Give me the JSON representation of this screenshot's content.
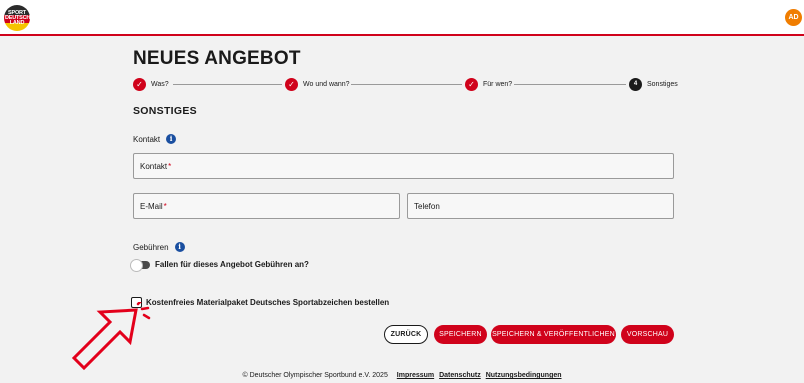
{
  "header": {
    "logo_lines": [
      "SPORT",
      "DEUTSCH",
      "LAND"
    ],
    "avatar_initials": "AD"
  },
  "page": {
    "title": "NEUES ANGEBOT"
  },
  "stepper": {
    "steps": [
      {
        "label": "Was?",
        "state": "done",
        "marker": "✓"
      },
      {
        "label": "Wo und wann?",
        "state": "done",
        "marker": "✓"
      },
      {
        "label": "Für wen?",
        "state": "done",
        "marker": "✓"
      },
      {
        "label": "Sonstiges",
        "state": "current",
        "marker": "4"
      }
    ]
  },
  "section": {
    "title": "SONSTIGES"
  },
  "contact": {
    "label": "Kontakt",
    "info_glyph": "i",
    "contact_field": {
      "placeholder": "Kontakt",
      "required_mark": "*"
    },
    "email_field": {
      "placeholder": "E-Mail",
      "required_mark": "*"
    },
    "phone_field": {
      "placeholder": "Telefon"
    }
  },
  "fees": {
    "label": "Gebühren",
    "info_glyph": "i",
    "toggle_label": "Fallen für dieses Angebot Gebühren an?",
    "toggle_on": false
  },
  "material": {
    "checkbox_label": "Kostenfreies Materialpaket Deutsches Sportabzeichen bestellen",
    "checked": false
  },
  "actions": {
    "back": "ZURÜCK",
    "save": "SPEICHERN",
    "save_publish": "SPEICHERN & VERÖFFENTLICHEN",
    "preview": "VORSCHAU"
  },
  "footer": {
    "copyright": "© Deutscher Olympischer Sportbund e.V. 2025",
    "links": [
      "Impressum",
      "Datenschutz",
      "Nutzungsbedingungen"
    ]
  },
  "colors": {
    "accent": "#d0021b",
    "info": "#1a4fa0",
    "avatar": "#f07d00"
  }
}
